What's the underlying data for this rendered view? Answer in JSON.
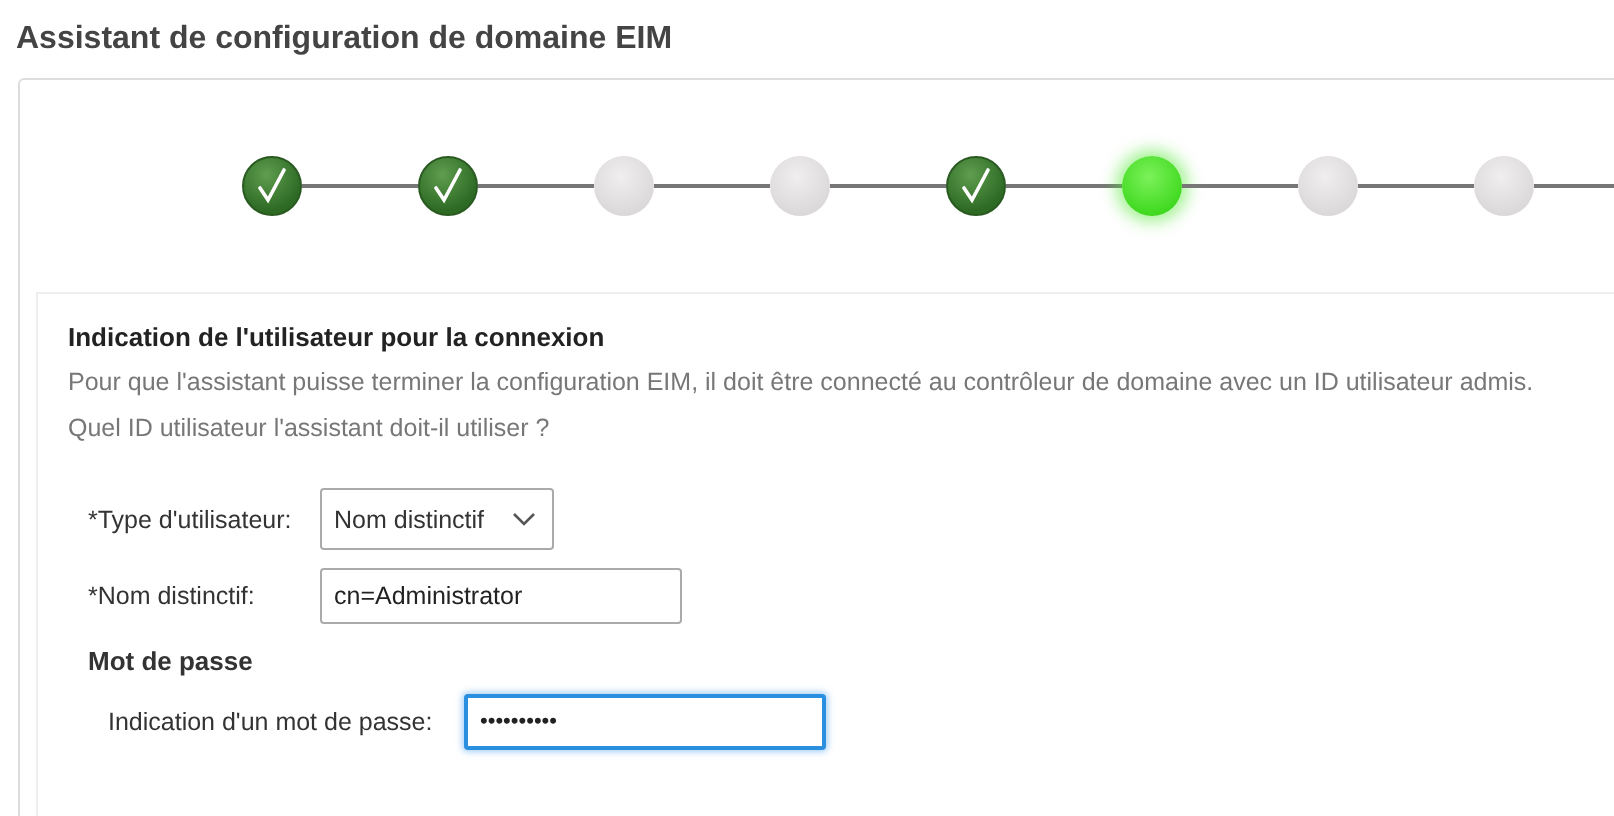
{
  "title": "Assistant de configuration de domaine EIM",
  "steps": [
    {
      "completed": true,
      "selected": false
    },
    {
      "completed": true,
      "selected": false
    },
    {
      "completed": false,
      "selected": false
    },
    {
      "completed": false,
      "selected": false
    },
    {
      "completed": true,
      "selected": false
    },
    {
      "completed": false,
      "selected": true
    },
    {
      "completed": false,
      "selected": false
    },
    {
      "completed": false,
      "selected": false
    }
  ],
  "section": {
    "heading": "Indication de l'utilisateur pour la connexion",
    "description": "Pour que l'assistant puisse terminer la configuration EIM, il doit être connecté au contrôleur de domaine avec un ID utilisateur admis.",
    "question": "Quel ID utilisateur l'assistant doit-il utiliser ?"
  },
  "fields": [
    {
      "kind": "select",
      "label": "*Type d'utilisateur:",
      "value": "Nom distinctif"
    },
    {
      "kind": "text",
      "label": "*Nom distinctif:",
      "value": "cn=Administrator"
    }
  ],
  "password": {
    "heading": "Mot de passe",
    "label": "Indication d'un mot de passe:",
    "value": "••••••••••",
    "focused": true
  }
}
